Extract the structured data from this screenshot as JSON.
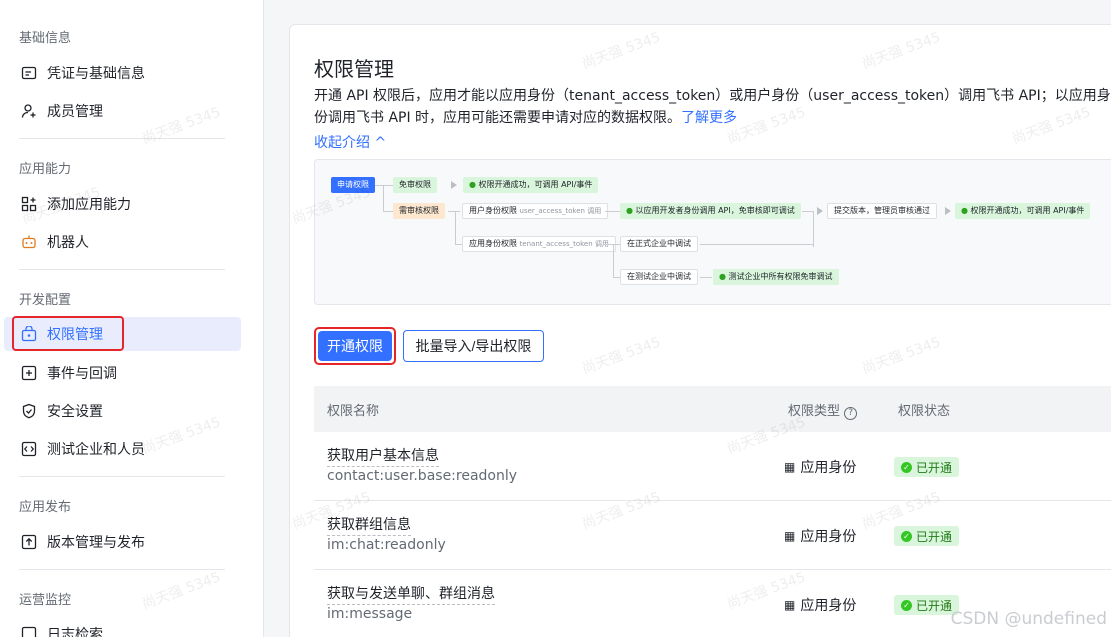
{
  "sidebar": {
    "sections": [
      {
        "title": "基础信息",
        "items": [
          {
            "label": "凭证与基础信息",
            "icon": "id-card-icon"
          },
          {
            "label": "成员管理",
            "icon": "add-user-icon"
          }
        ]
      },
      {
        "title": "应用能力",
        "items": [
          {
            "label": "添加应用能力",
            "icon": "grid-add-icon"
          },
          {
            "label": "机器人",
            "icon": "robot-icon"
          }
        ]
      },
      {
        "title": "开发配置",
        "items": [
          {
            "label": "权限管理",
            "icon": "lock-box-icon",
            "active": true
          },
          {
            "label": "事件与回调",
            "icon": "event-icon"
          },
          {
            "label": "安全设置",
            "icon": "shield-icon"
          },
          {
            "label": "测试企业和人员",
            "icon": "code-icon"
          }
        ]
      },
      {
        "title": "应用发布",
        "items": [
          {
            "label": "版本管理与发布",
            "icon": "upload-icon"
          }
        ]
      },
      {
        "title": "运营监控",
        "items": [
          {
            "label": "日志检索",
            "icon": "log-icon"
          }
        ]
      }
    ]
  },
  "main": {
    "title": "权限管理",
    "desc_text": "开通 API 权限后，应用才能以应用身份（tenant_access_token）或用户身份（user_access_token）调用飞书 API；以应用身份调用飞书 API 时，应用可能还需要申请对应的数据权限。",
    "learn_more": "了解更多",
    "collapse": "收起介绍 ^",
    "flow": {
      "apply": "申请权限",
      "free": "免审权限",
      "free_result": "权限开通成功，可调用 API/事件",
      "need_review": "需审核权限",
      "user_identity": "用户身份权限",
      "user_token": "user_access_token 调用",
      "dev_call": "以应用开发者身份调用 API，免审核即可调试",
      "submit": "提交版本，管理员审核通过",
      "final_result": "权限开通成功，可调用 API/事件",
      "app_identity": "应用身份权限",
      "tenant_token": "tenant_access_token 调用",
      "formal_debug": "在正式企业中调试",
      "test_debug": "在测试企业中调试",
      "test_free": "测试企业中所有权限免审调试"
    },
    "buttons": {
      "enable": "开通权限",
      "batch": "批量导入/导出权限"
    },
    "table": {
      "headers": {
        "name": "权限名称",
        "type": "权限类型",
        "status": "权限状态"
      },
      "rows": [
        {
          "name": "获取用户基本信息",
          "code": "contact:user.base:readonly",
          "type": "应用身份",
          "status": "已开通"
        },
        {
          "name": "获取群组信息",
          "code": "im:chat:readonly",
          "type": "应用身份",
          "status": "已开通"
        },
        {
          "name": "获取与发送单聊、群组消息",
          "code": "im:message",
          "type": "应用身份",
          "status": "已开通"
        }
      ]
    }
  },
  "watermark": "尚天强 5345",
  "footer_mark": "CSDN @undefined",
  "colors": {
    "accent": "#3370ff",
    "success": "#34c724",
    "highlight": "#e5252a"
  }
}
